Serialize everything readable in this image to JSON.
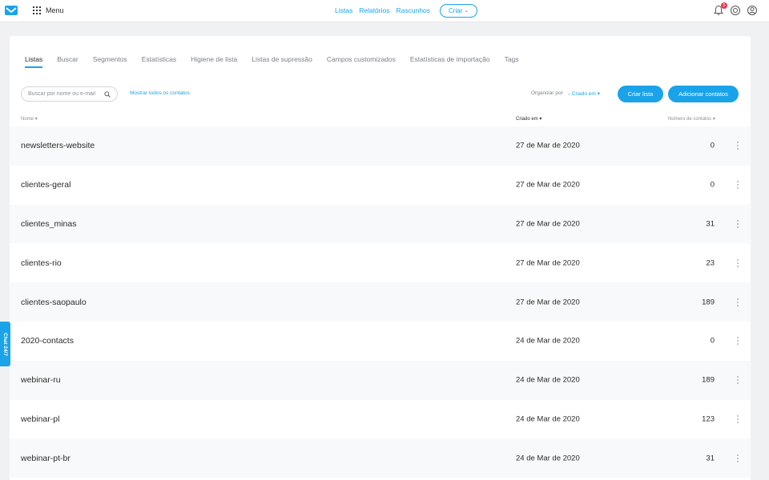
{
  "topbar": {
    "menu_label": "Menu",
    "nav": [
      "Listas",
      "Relatórios",
      "Rascunhos"
    ],
    "create_label": "Criar",
    "notification_count": "5",
    "accent_color": "#1aa3e8"
  },
  "tabs": [
    {
      "label": "Listas",
      "active": true
    },
    {
      "label": "Buscar"
    },
    {
      "label": "Segmentos"
    },
    {
      "label": "Estatísticas"
    },
    {
      "label": "Higiene de lista"
    },
    {
      "label": "Listas de supressão"
    },
    {
      "label": "Campos customizados"
    },
    {
      "label": "Estatísticas de importação"
    },
    {
      "label": "Tags"
    }
  ],
  "toolbar": {
    "search_placeholder": "Buscar por nome ou e-mail",
    "show_all_label": "Mostrar todos os contatos",
    "sort_label": "Organizar por",
    "sort_value": "Criado em",
    "create_list_label": "Criar lista",
    "add_contacts_label": "Adicionar contatos"
  },
  "table": {
    "headers": {
      "name": "Nome",
      "created": "Criado em",
      "count": "Número de contatos"
    },
    "rows": [
      {
        "name": "newsletters-website",
        "created": "27 de Mar de 2020",
        "count": "0"
      },
      {
        "name": "clientes-geral",
        "created": "27 de Mar de 2020",
        "count": "0"
      },
      {
        "name": "clientes_minas",
        "created": "27 de Mar de 2020",
        "count": "31"
      },
      {
        "name": "clientes-rio",
        "created": "27 de Mar de 2020",
        "count": "23"
      },
      {
        "name": "clientes-saopaulo",
        "created": "27 de Mar de 2020",
        "count": "189"
      },
      {
        "name": "2020-contacts",
        "created": "24 de Mar de 2020",
        "count": "0"
      },
      {
        "name": "webinar-ru",
        "created": "24 de Mar de 2020",
        "count": "189"
      },
      {
        "name": "webinar-pl",
        "created": "24 de Mar de 2020",
        "count": "123"
      },
      {
        "name": "webinar-pt-br",
        "created": "24 de Mar de 2020",
        "count": "31"
      }
    ]
  },
  "chat_label": "Chat 24/7"
}
